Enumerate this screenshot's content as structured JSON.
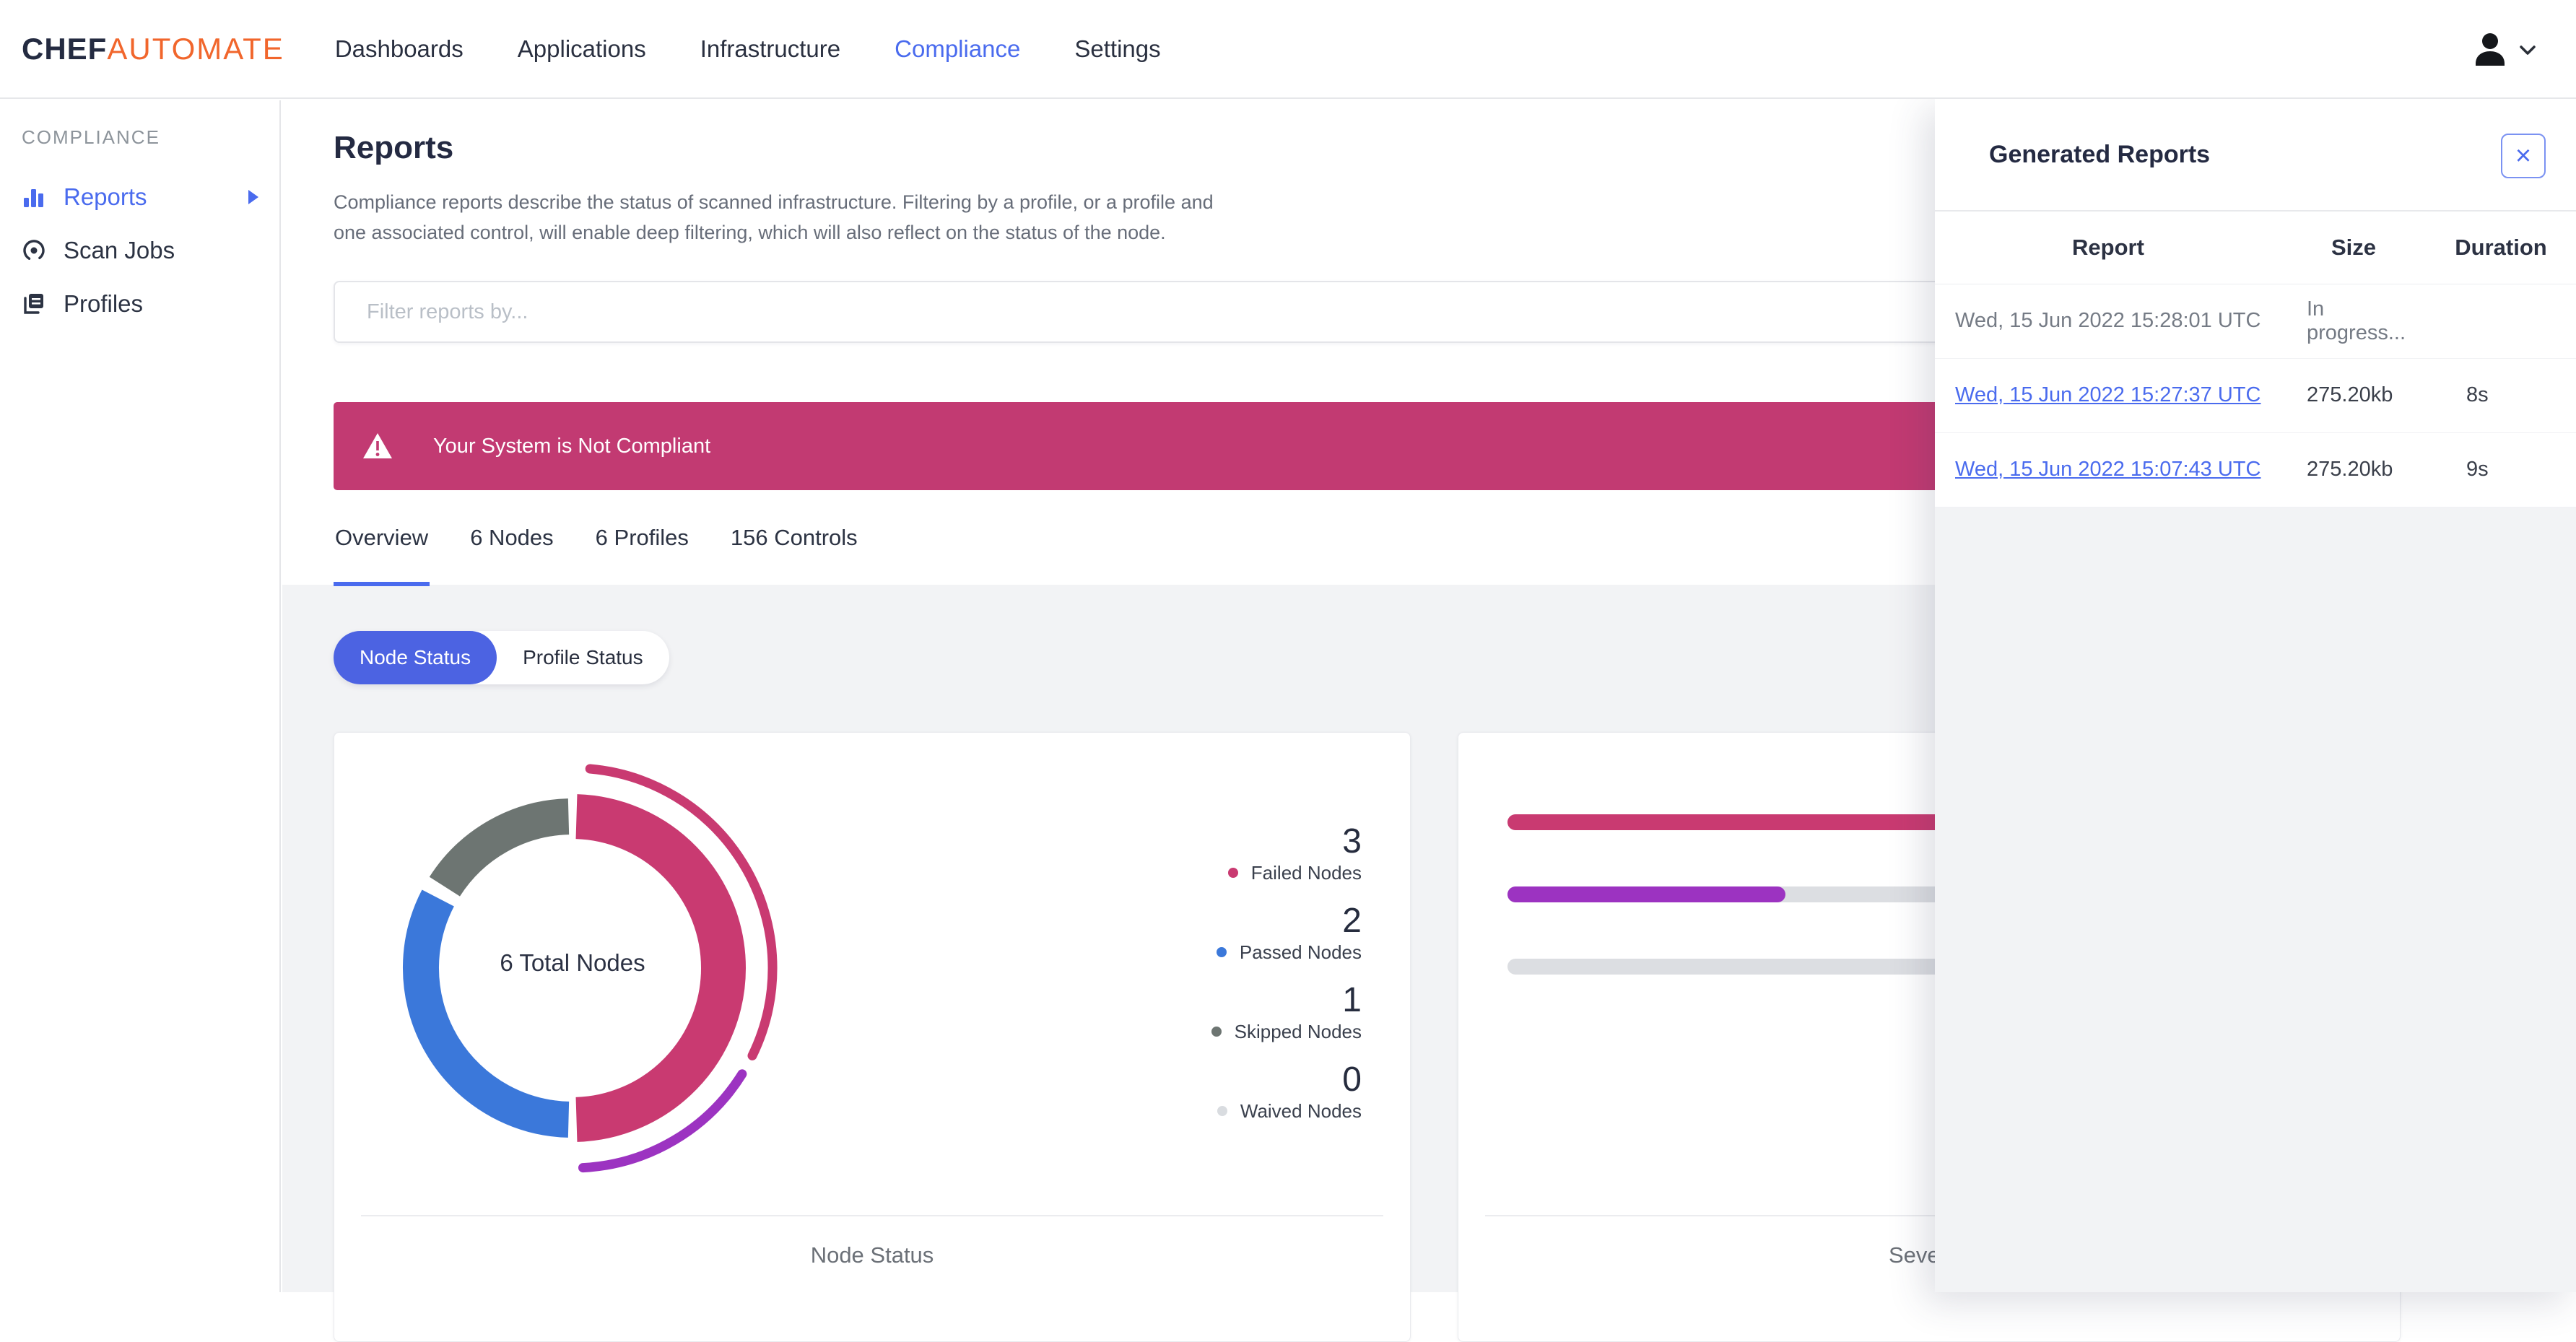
{
  "colors": {
    "accent_blue": "#4a6bee",
    "toggle_blue": "#4c63e2",
    "brand_orange": "#f1662c",
    "alert_magenta": "#c23a72",
    "failed_pink": "#c93a71",
    "passed_blue": "#3b78da",
    "skipped_gray": "#6d7572",
    "waived_gray": "#d9dce0",
    "severity_purple": "#9c33c1",
    "page_gray": "#f2f3f5"
  },
  "nav": {
    "brand_bold": "CHEF",
    "brand_light": "AUTOMATE",
    "items": [
      {
        "label": "Dashboards"
      },
      {
        "label": "Applications"
      },
      {
        "label": "Infrastructure"
      },
      {
        "label": "Compliance"
      },
      {
        "label": "Settings"
      }
    ]
  },
  "sidebar": {
    "section": "COMPLIANCE",
    "items": [
      {
        "label": "Reports",
        "icon": "bar-chart-icon",
        "active": true
      },
      {
        "label": "Scan Jobs",
        "icon": "scan-icon",
        "active": false
      },
      {
        "label": "Profiles",
        "icon": "profiles-icon",
        "active": false
      }
    ]
  },
  "main": {
    "title": "Reports",
    "description": "Compliance reports describe the status of scanned infrastructure. Filtering by a profile, or a profile and one associated control, will enable deep filtering, which will also reflect on the status of the node.",
    "filter_placeholder": "Filter reports by...",
    "alert_text": "Your System is Not Compliant",
    "tabs": [
      {
        "label": "Overview",
        "active": true
      },
      {
        "label": "6 Nodes",
        "active": false
      },
      {
        "label": "6 Profiles",
        "active": false
      },
      {
        "label": "156 Controls",
        "active": false
      }
    ],
    "toggle": [
      {
        "label": "Node Status",
        "active": true
      },
      {
        "label": "Profile Status",
        "active": false
      }
    ]
  },
  "node_status_card": {
    "center_label": "6 Total Nodes",
    "caption": "Node Status",
    "legend": [
      {
        "value": "3",
        "label": "Failed Nodes",
        "color": "#c93a71"
      },
      {
        "value": "2",
        "label": "Passed Nodes",
        "color": "#3b78da"
      },
      {
        "value": "1",
        "label": "Skipped Nodes",
        "color": "#6d7572"
      },
      {
        "value": "0",
        "label": "Waived Nodes",
        "color": "#d9dce0"
      }
    ]
  },
  "severity_card": {
    "caption": "Severity"
  },
  "chart_data": [
    {
      "type": "pie",
      "title": "Node Status",
      "center_label": "6 Total Nodes",
      "categories": [
        "Failed Nodes",
        "Passed Nodes",
        "Skipped Nodes",
        "Waived Nodes"
      ],
      "values": [
        3,
        2,
        1,
        0
      ],
      "colors": [
        "#c93a71",
        "#3b78da",
        "#6d7572",
        "#d9dce0"
      ],
      "outer_arc_split": {
        "pink_fraction": 0.67,
        "purple_fraction": 0.33
      },
      "legend_position": "right"
    },
    {
      "type": "bar",
      "title": "Severity",
      "orientation": "horizontal",
      "series": [
        {
          "color": "#c93a71",
          "fill_fraction": 1.0
        },
        {
          "color": "#9c33c1",
          "fill_fraction": 0.33
        },
        {
          "color": "#dcdee2",
          "fill_fraction": 0.0
        }
      ]
    }
  ],
  "panel": {
    "title": "Generated Reports",
    "close_glyph": "×",
    "columns": [
      "Report",
      "Size",
      "Duration"
    ],
    "rows": [
      {
        "report": "Wed, 15 Jun 2022 15:28:01 UTC",
        "size": "In progress...",
        "duration": ""
      },
      {
        "report": "Wed, 15 Jun 2022 15:27:37 UTC",
        "size": "275.20kb",
        "duration": "8s"
      },
      {
        "report": "Wed, 15 Jun 2022 15:07:43 UTC",
        "size": "275.20kb",
        "duration": "9s"
      }
    ]
  }
}
